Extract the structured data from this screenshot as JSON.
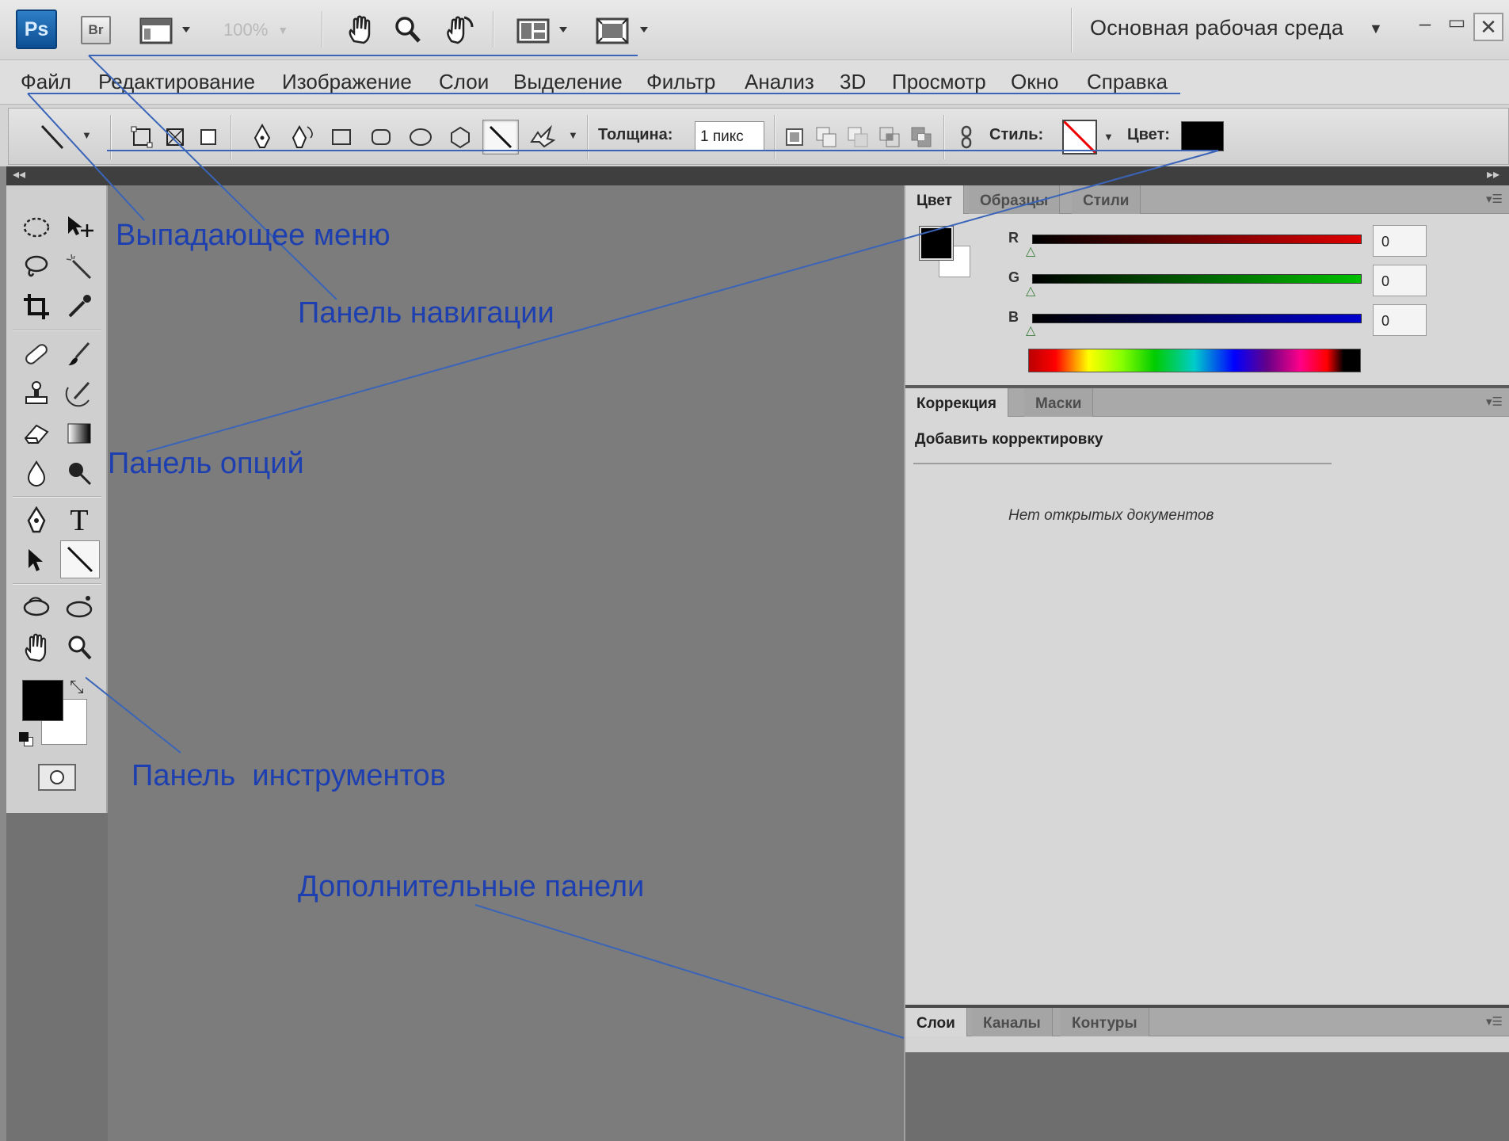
{
  "app_bar": {
    "logo": "Ps",
    "bridge_label": "Br",
    "zoom_level": "100%",
    "workspace": "Основная рабочая среда",
    "icons": [
      "screen-view-icon",
      "hand-icon",
      "zoom-icon",
      "rotate-view-icon",
      "arrange-documents-icon",
      "screen-mode-icon",
      "minimize-icon",
      "maximize-icon",
      "close-icon"
    ]
  },
  "menu": {
    "items": [
      "Файл",
      "Редактирование",
      "Изображение",
      "Слои",
      "Выделение",
      "Фильтр",
      "Анализ",
      "3D",
      "Просмотр",
      "Окно",
      "Справка"
    ]
  },
  "options_bar": {
    "thickness_label": "Толщина:",
    "thickness_value": "1 пикс",
    "style_label": "Стиль:",
    "color_label": "Цвет:",
    "color_value": "#000000"
  },
  "color_panel": {
    "tabs": [
      "Цвет",
      "Образцы",
      "Стили"
    ],
    "channels": [
      {
        "label": "R",
        "value": "0",
        "color": "#e00000"
      },
      {
        "label": "G",
        "value": "0",
        "color": "#00c000"
      },
      {
        "label": "B",
        "value": "0",
        "color": "#0000d0"
      }
    ],
    "foreground": "#000000",
    "background": "#ffffff"
  },
  "adjustments_panel": {
    "tabs": [
      "Коррекция",
      "Маски"
    ],
    "heading": "Добавить корректировку",
    "empty_message": "Нет открытых документов"
  },
  "layers_panel": {
    "tabs": [
      "Слои",
      "Каналы",
      "Контуры"
    ]
  },
  "annotations": {
    "dropdown_menu": "Выпадающее меню",
    "navigation_panel": "Панель навигации",
    "options_panel": "Панель опций",
    "tools_panel": "Панель  инструментов",
    "extra_panels": "Дополнительные панели"
  },
  "colors": {
    "annotation": "#1d3fb0",
    "canvas": "#7c7c7c"
  }
}
